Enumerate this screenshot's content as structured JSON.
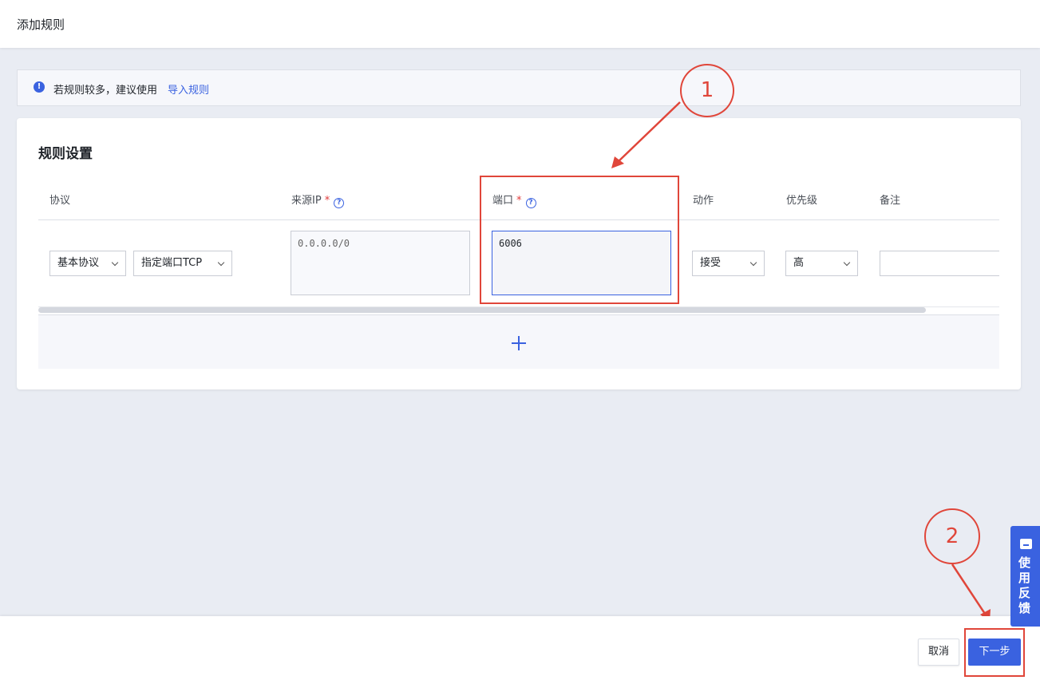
{
  "header": {
    "title": "添加规则"
  },
  "notice": {
    "text": "若规则较多，建议使用",
    "link": "导入规则"
  },
  "rule_settings": {
    "title": "规则设置",
    "columns": {
      "protocol": "协议",
      "source_ip": "来源IP",
      "port": "端口",
      "action": "动作",
      "priority": "优先级",
      "remark": "备注"
    },
    "required_mark": "*",
    "help_glyph": "?",
    "row": {
      "protocol_type": "基本协议",
      "protocol_port": "指定端口TCP",
      "source_ip_placeholder": "0.0.0.0/0",
      "port_value": "6006",
      "action": "接受",
      "priority": "高",
      "remark": ""
    },
    "add_icon": "plus-icon"
  },
  "annotations": {
    "marker_1": "1",
    "marker_2": "2"
  },
  "footer": {
    "cancel_label": "取消",
    "next_label": "下一步"
  },
  "feedback": {
    "label": "使用反馈"
  },
  "colors": {
    "primary": "#3a62e0",
    "annotation": "#e0463a",
    "background": "#e9ecf3"
  }
}
